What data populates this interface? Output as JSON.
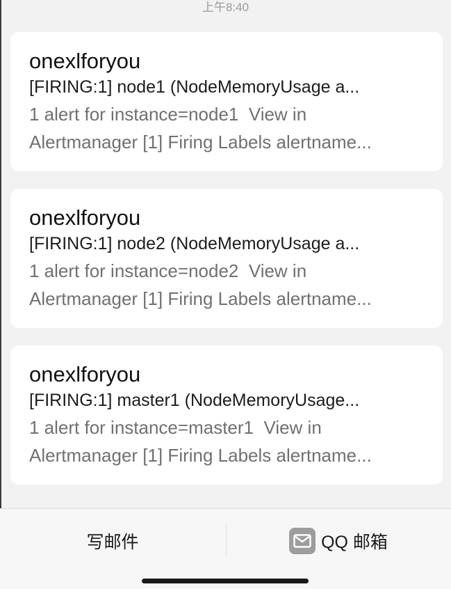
{
  "status_bar": {
    "time": "上午8:40"
  },
  "messages": [
    {
      "sender": "onexlforyou",
      "subject": "[FIRING:1] node1 (NodeMemoryUsage a...",
      "preview": "1 alert for instance=node1  View in\nAlertmanager [1] Firing Labels alertname..."
    },
    {
      "sender": "onexlforyou",
      "subject": "[FIRING:1] node2 (NodeMemoryUsage a...",
      "preview": "1 alert for instance=node2  View in\nAlertmanager [1] Firing Labels alertname..."
    },
    {
      "sender": "onexlforyou",
      "subject": "[FIRING:1] master1 (NodeMemoryUsage...",
      "preview": "1 alert for instance=master1  View in\nAlertmanager [1] Firing Labels alertname..."
    }
  ],
  "toolbar": {
    "compose_label": "写邮件",
    "qq_mail_label": "QQ 邮箱"
  },
  "icons": {
    "mail": "mail-icon"
  }
}
